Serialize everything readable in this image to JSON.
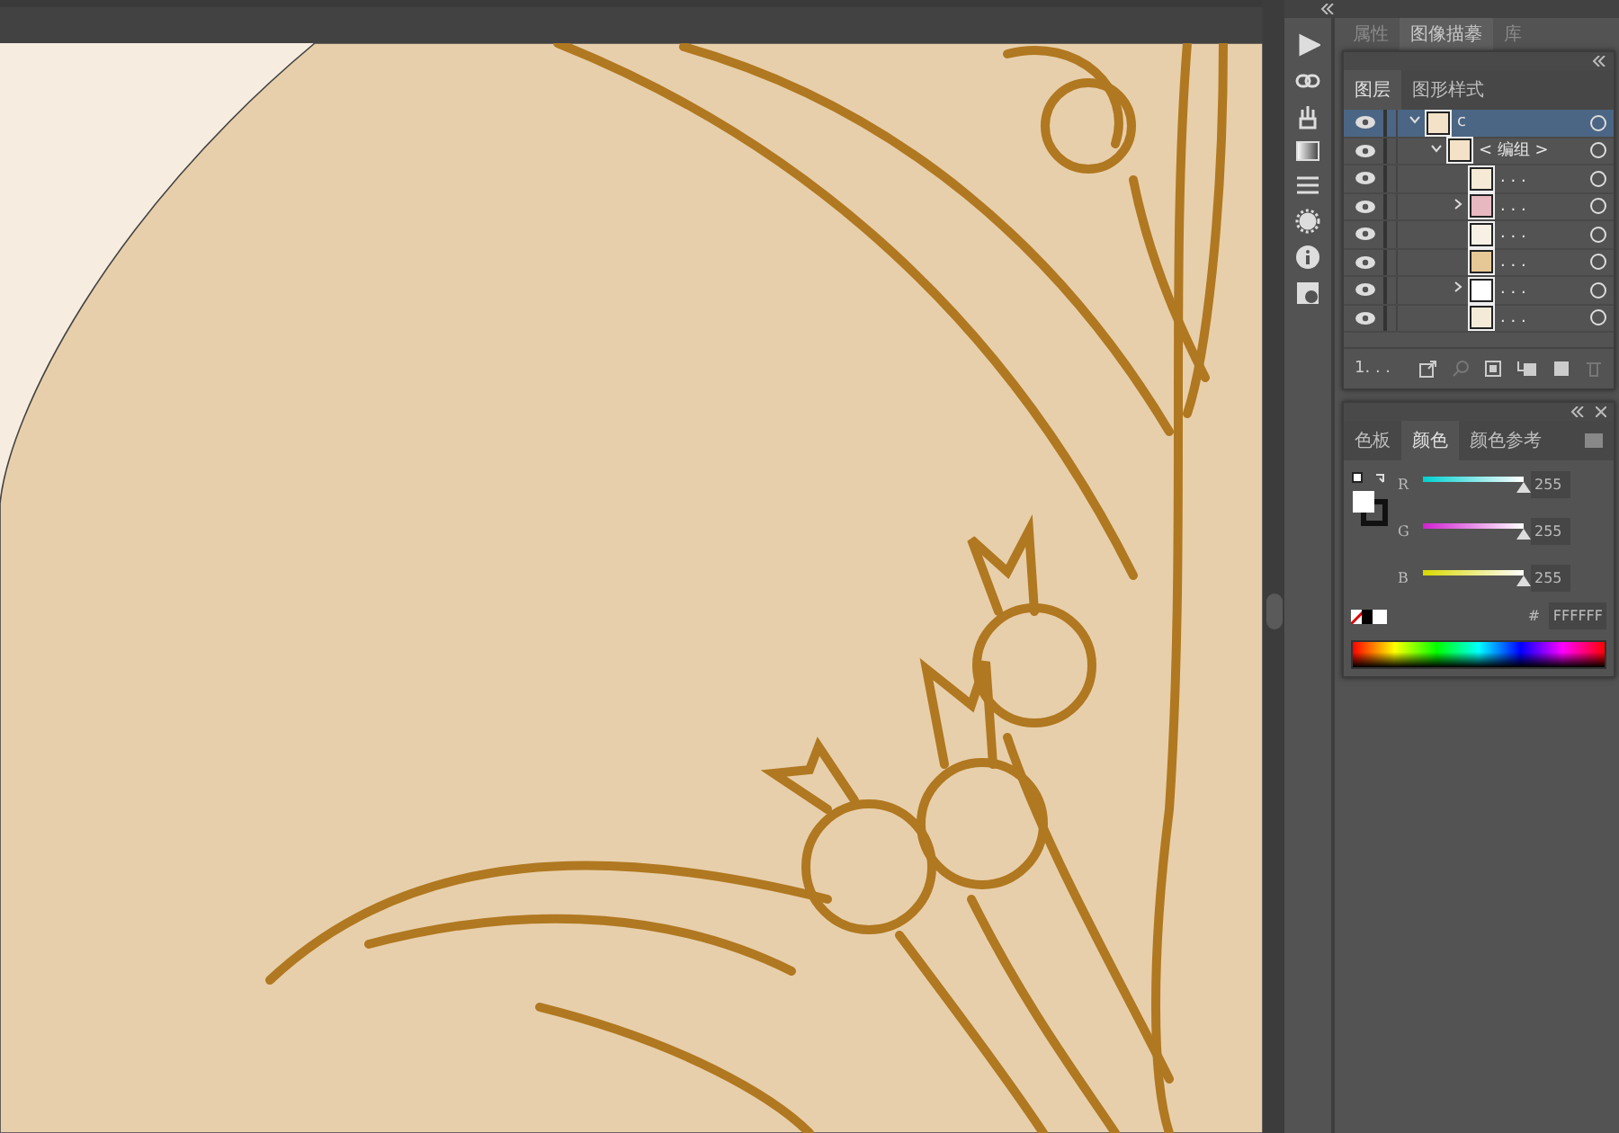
{
  "dock_tabs": [
    {
      "label": "属性",
      "selected": false
    },
    {
      "label": "图像描摹",
      "selected": true
    },
    {
      "label": "库",
      "selected": false
    }
  ],
  "layers_panel": {
    "tabs": [
      {
        "label": "图层",
        "selected": true
      },
      {
        "label": "图形样式",
        "selected": false
      }
    ],
    "layers": [
      {
        "name": "c",
        "selected": true,
        "expanded": true,
        "color": "#f3e2c8",
        "children": [
          {
            "name": "< 编组 >",
            "selected": false,
            "expanded": true,
            "color": "#f3e2c8",
            "children": [
              {
                "name": ". . .",
                "selected": false,
                "color": "#f6ead6"
              },
              {
                "name": ". . .",
                "selected": false,
                "expanded": false,
                "color": "#e8b8c0"
              },
              {
                "name": ". . .",
                "selected": false,
                "color": "#f8f0e4"
              },
              {
                "name": ". . .",
                "selected": false,
                "color": "#e6c796"
              },
              {
                "name": ". . .",
                "selected": false,
                "expanded": false,
                "color": "#ffffff"
              },
              {
                "name": ". . .",
                "selected": false,
                "color": "#f5ead8"
              }
            ]
          }
        ]
      }
    ],
    "footer": "1. . ."
  },
  "color_panel": {
    "tabs": [
      {
        "label": "色板",
        "selected": false
      },
      {
        "label": "颜色",
        "selected": true
      },
      {
        "label": "颜色参考",
        "selected": false
      }
    ],
    "channels": [
      {
        "name": "R",
        "level": 1,
        "value": "255",
        "kind": "red"
      },
      {
        "name": "G",
        "level": 1,
        "value": "255",
        "kind": "green"
      },
      {
        "name": "B",
        "level": 1,
        "value": "255",
        "kind": "blue"
      }
    ],
    "hex_label": "#",
    "hex": "FFFFFF"
  }
}
